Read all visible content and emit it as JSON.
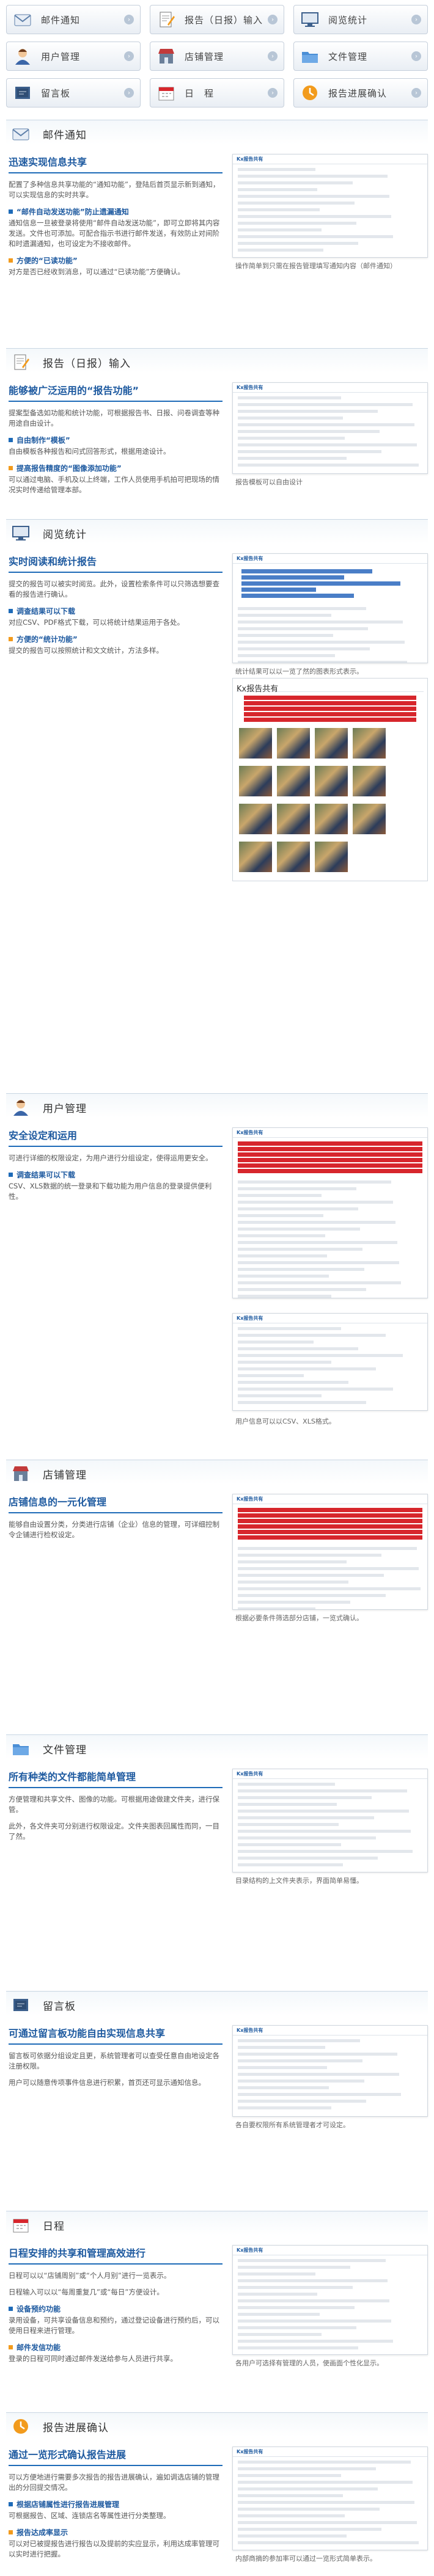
{
  "nav": [
    {
      "label": "邮件通知",
      "icon": "mail-icon"
    },
    {
      "label": "报告（日报）输入",
      "icon": "report-edit-icon"
    },
    {
      "label": "阅览统计",
      "icon": "monitor-icon"
    },
    {
      "label": "用户管理",
      "icon": "user-icon"
    },
    {
      "label": "店铺管理",
      "icon": "store-icon"
    },
    {
      "label": "文件管理",
      "icon": "folder-icon"
    },
    {
      "label": "留言板",
      "icon": "board-icon"
    },
    {
      "label": "日　程",
      "icon": "calendar-icon"
    },
    {
      "label": "报告进展确认",
      "icon": "progress-icon"
    }
  ],
  "brand": {
    "logo_text": "Kx报告共有",
    "accent": "#1e5aa0",
    "red": "#d7262c",
    "orange": "#f29b1d"
  },
  "sections": [
    {
      "head": "邮件通知",
      "title": "迅速实现信息共享",
      "paras": [
        "配置了多种信息共享功能的“通知功能”，登陆后首页显示新到通知，可以实现信息的实时共享。"
      ],
      "bullets": [
        {
          "h": "“邮件自动发送功能”防止遗漏通知",
          "t": "通知信息一旦被登录将使用“邮件自动发送功能”，即可立即将其内容发送。文件也可添加。可配合指示书进行邮件发送，有效防止对间阶和时遗漏通知，也可设定为不接收邮件。"
        },
        {
          "h": "方便的“已读功能”",
          "t": "对方是否已经收到消息，可以通过“已读功能”方便确认。"
        }
      ],
      "caption": "操作简单到只需在报告管理填写通知内容（邮件通知）"
    },
    {
      "head": "报告（日报）输入",
      "title": "能够被广泛运用的“报告功能”",
      "paras": [
        "提案型备选如功能和统计功能，可根据报告书、日报、问卷调查等种用途自由设计。"
      ],
      "bullets": [
        {
          "h": "自由制作“模板”",
          "t": "自由模板各种报告和问式回答形式，根据用途设计。"
        },
        {
          "h": "提高报告精度的“图像添加功能”",
          "t": "可以通过电脑、手机及以上终端，工作人员使用手机拍可把现场的情况实时传递给管理本部。"
        }
      ],
      "caption": "报告模板可以自由设计"
    },
    {
      "head": "阅览统计",
      "title": "实时阅读和统计报告",
      "paras": [
        "提交的报告可以被实时阅览。此外，设置检索条件可以只筛选想要查看的报告进行确认。"
      ],
      "bullets": [
        {
          "h": "调查结果可以下载",
          "t": "对应CSV、PDF格式下载，可以将统计结果运用于各处。"
        },
        {
          "h": "方便的“统计功能”",
          "t": "提交的报告可以按照统计和文文统计，方法多样。"
        }
      ],
      "caption": "统计结果可以以一览了然的图表形式表示。"
    },
    {
      "head": "用户管理",
      "title": "安全设定和运用",
      "paras": [
        "可进行详细的权限设定，为用户进行分组设定，使得运用更安全。"
      ],
      "bullets": [
        {
          "h": "调查结果可以下载",
          "t": "CSV、XLS数据的统一登录和下载功能为用户信息的登录提供便利性。"
        }
      ],
      "caption": "用户信息可以以CSV、XLS格式。"
    },
    {
      "head": "店铺管理",
      "title": "店铺信息的一元化管理",
      "paras": [
        "能够自由设置分类，分类进行店铺（企业）信息的管理，可详细控制令企铺进行检权设定。"
      ],
      "bullets": [],
      "caption": "根据必要条件筛选部分店铺，一览式确认。"
    },
    {
      "head": "文件管理",
      "title": "所有种类的文件都能简单管理",
      "paras": [
        "方便管理和共享文件、图像的功能。可根据用途做建文件夹，进行保管。",
        "此外，各文件夹可分别进行权限设定。文件夹图表回属性而同，一目了然。"
      ],
      "bullets": [],
      "caption": "目录结构的上文件夹表示，界面简单易懂。"
    },
    {
      "head": "留言板",
      "title": "可通过留言板功能自由实现信息共享",
      "paras": [
        "留言板可依据分组设定且更，系统管理者可以查受任意自由地设定各注册权限。",
        "用户可以随意传项事件信息进行积累，首页还可显示通知信息。"
      ],
      "bullets": [],
      "caption": "各自要权限所有系统管理者才可设定。"
    },
    {
      "head": "日程",
      "title": "日程安排的共享和管理高效进行",
      "paras": [
        "日程可以以“店铺周别”或“个人月别”进行一览表示。",
        "日程输入可以以“每周重复几”或“每日”方便设计。"
      ],
      "bullets": [
        {
          "h": "设备预约功能",
          "t": "录用设备，可共享设备信息和预约，通过登记设备进行预约后，可以使用日程来进行管理。"
        },
        {
          "h": "邮件发信功能",
          "t": "登录的日程可同时通过邮件发送给参与人员进行共享。"
        }
      ],
      "caption": "各用户可选择有管理的人员，使画面个性化显示。"
    },
    {
      "head": "报告进展确认",
      "title": "通过一览形式确认报告进展",
      "paras": [
        "可以方便地进行需要多次报告的报告进展确认，遍如调选店铺的管理出的分回提交情况。"
      ],
      "bullets": [
        {
          "h": "根据店铺属性进行报告进展管理",
          "t": "可根据报告、区域、连锁店名等属性进行分类整理。"
        },
        {
          "h": "报告达成率显示",
          "t": "可以对已被提报告进行报告以及提前的实应显示，利用达成率管理可以实时进行把握。"
        }
      ],
      "caption": "内部商摘的参加率可以通过一览形式简单表示。"
    }
  ]
}
